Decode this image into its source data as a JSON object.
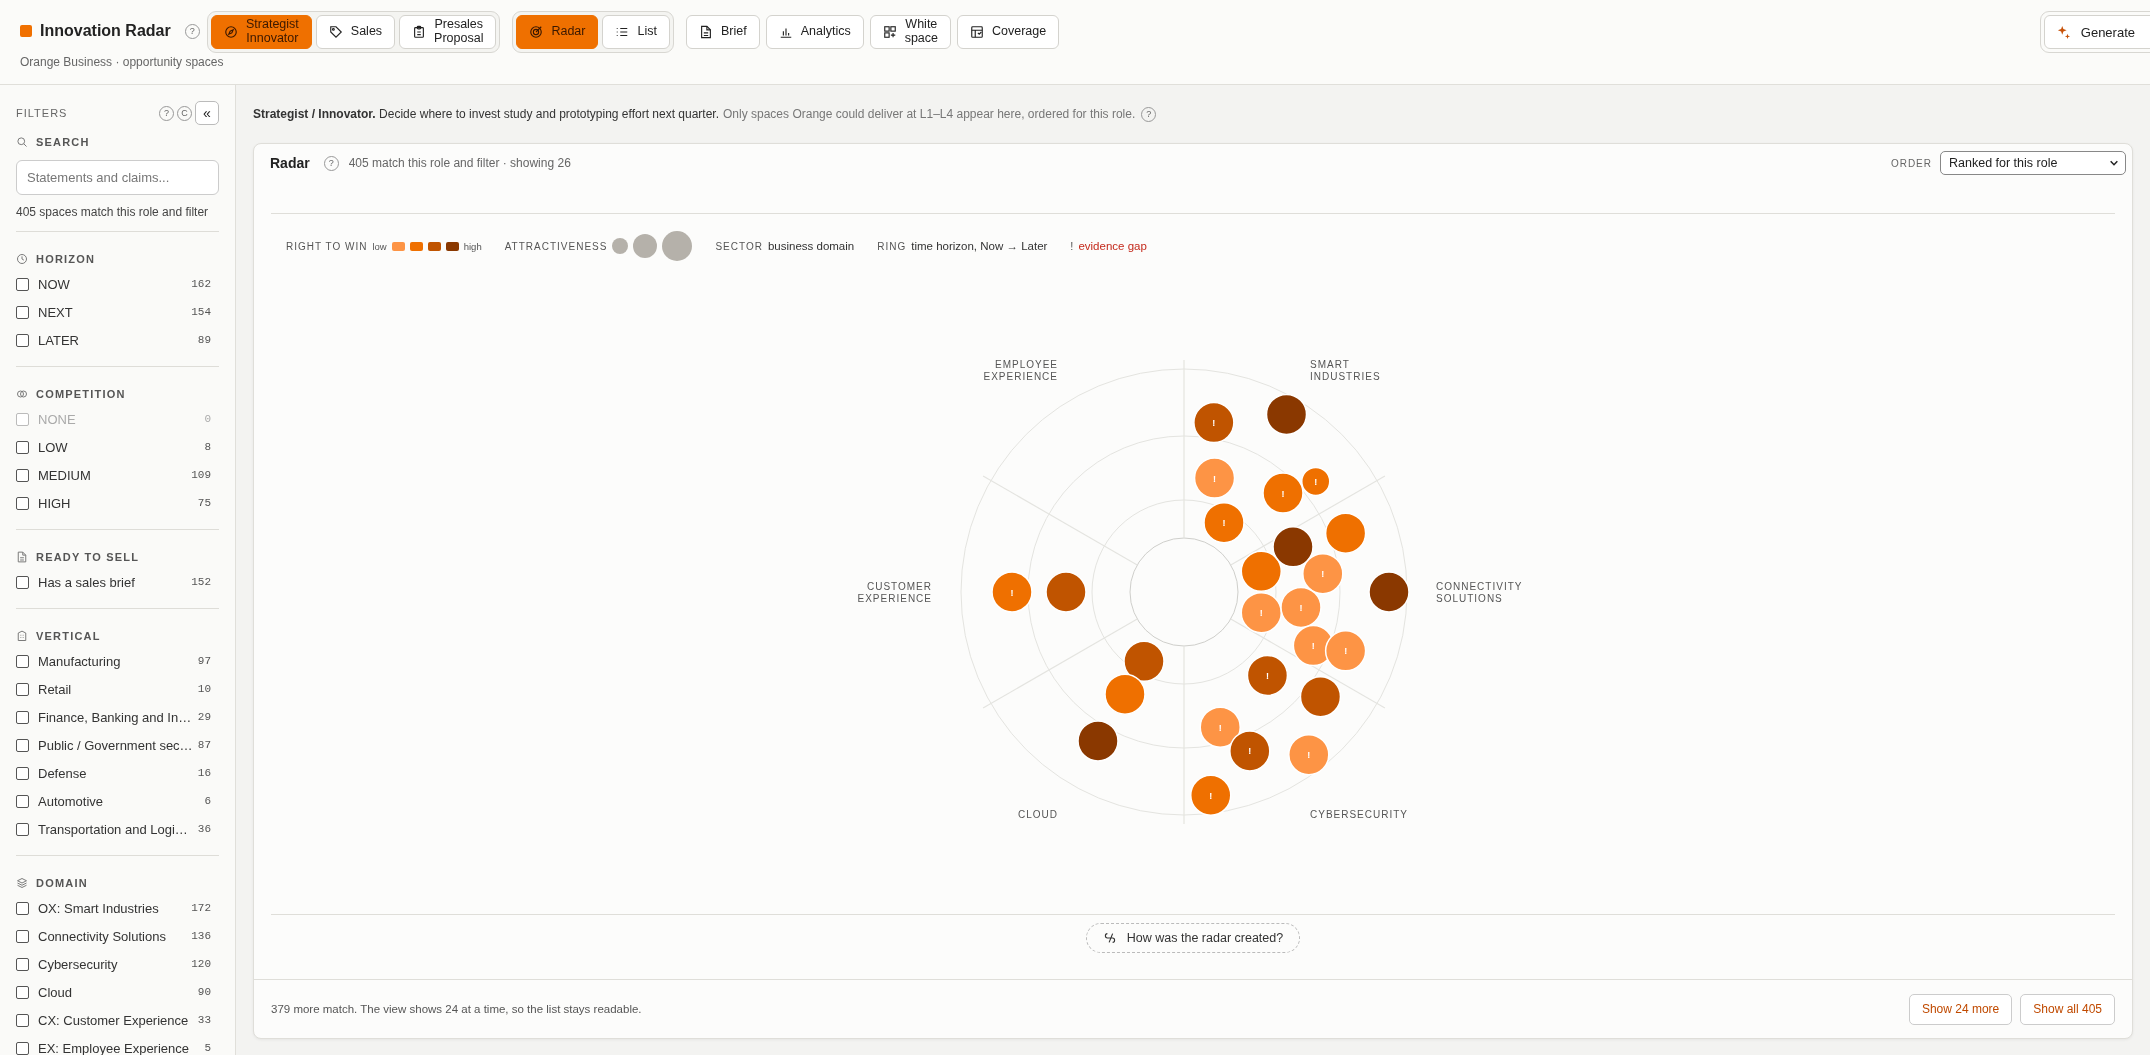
{
  "app": {
    "title": "Innovation Radar",
    "help": "?",
    "subtitle": "Orange Business · opportunity spaces"
  },
  "roles": [
    {
      "label": "Strategist Innovator",
      "selected": true
    },
    {
      "label": "Sales",
      "selected": false
    },
    {
      "label": "Presales Proposal",
      "selected": false
    }
  ],
  "views": [
    {
      "label": "Radar",
      "selected": true
    },
    {
      "label": "List",
      "selected": false
    }
  ],
  "tools": [
    "Brief",
    "Analytics",
    "White space",
    "Coverage"
  ],
  "generate": "Generate",
  "filters": {
    "title": "FILTERS",
    "help": "?",
    "clear": "C",
    "collapse": "«",
    "search": {
      "heading": "SEARCH",
      "placeholder": "Statements and claims...",
      "summary": "405 spaces match this role and filter"
    },
    "groups": [
      {
        "heading": "HORIZON",
        "options": [
          {
            "label": "NOW",
            "count": "162",
            "checked": false,
            "disabled": false
          },
          {
            "label": "NEXT",
            "count": "154",
            "checked": false,
            "disabled": false
          },
          {
            "label": "LATER",
            "count": "89",
            "checked": false,
            "disabled": false
          }
        ]
      },
      {
        "heading": "COMPETITION",
        "options": [
          {
            "label": "NONE",
            "count": "0",
            "checked": false,
            "disabled": true
          },
          {
            "label": "LOW",
            "count": "8",
            "checked": false,
            "disabled": false
          },
          {
            "label": "MEDIUM",
            "count": "109",
            "checked": false,
            "disabled": false
          },
          {
            "label": "HIGH",
            "count": "75",
            "checked": false,
            "disabled": false
          }
        ]
      },
      {
        "heading": "READY TO SELL",
        "options": [
          {
            "label": "Has a sales brief",
            "count": "152",
            "checked": false,
            "disabled": false
          }
        ]
      },
      {
        "heading": "VERTICAL",
        "options": [
          {
            "label": "Manufacturing",
            "count": "97",
            "checked": false,
            "disabled": false
          },
          {
            "label": "Retail",
            "count": "10",
            "checked": false,
            "disabled": false
          },
          {
            "label": "Finance, Banking and In…",
            "count": "29",
            "checked": false,
            "disabled": false
          },
          {
            "label": "Public / Government sec…",
            "count": "87",
            "checked": false,
            "disabled": false
          },
          {
            "label": "Defense",
            "count": "16",
            "checked": false,
            "disabled": false
          },
          {
            "label": "Automotive",
            "count": "6",
            "checked": false,
            "disabled": false
          },
          {
            "label": "Transportation and Logi…",
            "count": "36",
            "checked": false,
            "disabled": false
          }
        ]
      },
      {
        "heading": "DOMAIN",
        "options": [
          {
            "label": "OX: Smart Industries",
            "count": "172",
            "checked": false,
            "disabled": false
          },
          {
            "label": "Connectivity Solutions",
            "count": "136",
            "checked": false,
            "disabled": false
          },
          {
            "label": "Cybersecurity",
            "count": "120",
            "checked": false,
            "disabled": false
          },
          {
            "label": "Cloud",
            "count": "90",
            "checked": false,
            "disabled": false
          },
          {
            "label": "CX: Customer Experience",
            "count": "33",
            "checked": false,
            "disabled": false
          },
          {
            "label": "EX: Employee Experience",
            "count": "5",
            "checked": false,
            "disabled": false
          }
        ]
      }
    ]
  },
  "intro": {
    "lead": "**Strategist / Innovator.** Decide where to invest study and prototyping effort next quarter.",
    "note": "Only spaces Orange could deliver at L1–L4 appear here, ordered for this role.",
    "help": "?"
  },
  "panel": {
    "title": "Radar",
    "help": "?",
    "summary": "405 match this role and filter · showing 26",
    "order_label": "ORDER",
    "order_value": "Ranked for this role"
  },
  "legend": {
    "rtw_label": "RIGHT TO WIN",
    "low": "low",
    "high": "high",
    "swatches": [
      {
        "color": "#fd9445"
      },
      {
        "color": "#ef7000"
      },
      {
        "color": "#c05400"
      },
      {
        "color": "#8a3800"
      }
    ],
    "attr_label": "ATTRACTIVENESS",
    "sector_label": "SECTOR",
    "sector_text": "business domain",
    "ring_label": "RING",
    "ring_text": "time horizon, Now → Later",
    "gap_mark": "!",
    "gap_text": "evidence gap"
  },
  "sectors": [
    {
      "label": "EMPLOYEE EXPERIENCE"
    },
    {
      "label": "SMART INDUSTRIES",
      "now": [
        {
          "color": "#ef7000",
          "small": false,
          "mark": "!"
        }
      ],
      "next": [
        {
          "color": "#fd9445",
          "small": false,
          "mark": "!"
        },
        {
          "color": "#ef7000",
          "small": false,
          "mark": "!"
        }
      ],
      "later": [
        {
          "color": "#c05400",
          "small": false,
          "mark": "!"
        },
        {
          "color": "#8a3800",
          "small": false
        },
        {
          "color": "#ef7000",
          "small": true,
          "mark": "!"
        }
      ]
    },
    {
      "label": "CUSTOMER EXPERIENCE",
      "next": [
        {
          "color": "#c05400",
          "small": false
        }
      ],
      "later": [
        {
          "color": "#ef7000",
          "small": false,
          "mark": "!"
        }
      ]
    },
    {
      "label": "CONNECTIVITY SOLUTIONS",
      "now": [
        {
          "color": "#ef7000",
          "small": false
        },
        {
          "color": "#fd9445",
          "small": false,
          "mark": "!"
        }
      ],
      "next": [
        {
          "color": "#8a3800",
          "small": false
        },
        {
          "color": "#fd9445",
          "small": false,
          "mark": "!"
        },
        {
          "color": "#fd9445",
          "small": false,
          "mark": "!"
        },
        {
          "color": "#fd9445",
          "small": false,
          "mark": "!"
        }
      ],
      "later": [
        {
          "color": "#ef7000",
          "small": false
        },
        {
          "color": "#8a3800",
          "small": false
        },
        {
          "color": "#fd9445",
          "small": false,
          "mark": "!"
        }
      ]
    },
    {
      "label": "CLOUD",
      "now": [
        {
          "color": "#c05400",
          "small": false
        }
      ],
      "next": [
        {
          "color": "#ef7000",
          "small": false
        }
      ],
      "later": [
        {
          "color": "#8a3800",
          "small": false
        }
      ]
    },
    {
      "label": "CYBERSECURITY",
      "next": [
        {
          "color": "#c05400",
          "small": false,
          "mark": "!"
        },
        {
          "color": "#fd9445",
          "small": false,
          "mark": "!"
        }
      ],
      "later": [
        {
          "color": "#c05400",
          "small": false
        },
        {
          "color": "#fd9445",
          "small": false,
          "mark": "!"
        },
        {
          "color": "#c05400",
          "small": false,
          "mark": "!"
        },
        {
          "color": "#ef7000",
          "small": false,
          "mark": "!"
        }
      ]
    }
  ],
  "how": "How was the radar created?",
  "footer": {
    "text": "379 more match. The view shows 24 at a time, so the list stays readable.",
    "buttons": [
      "Show 24 more",
      "Show all 405"
    ]
  }
}
